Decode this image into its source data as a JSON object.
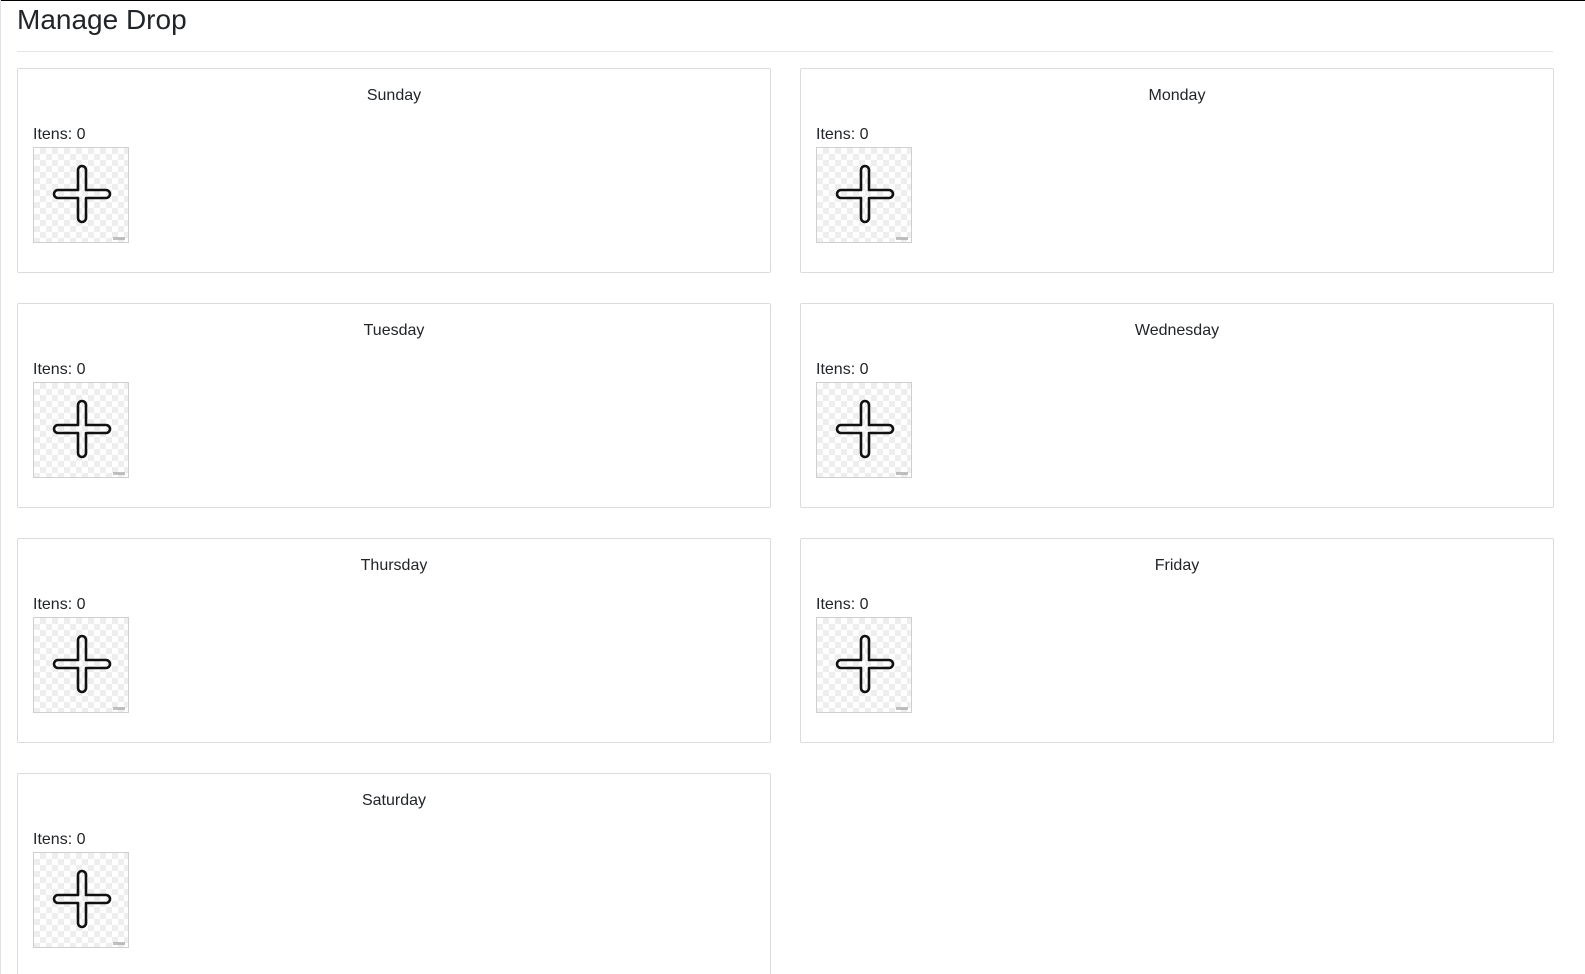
{
  "page": {
    "title": "Manage Drop"
  },
  "days": [
    {
      "name": "Sunday",
      "items_label": "Itens: 0",
      "add_icon": "plus-icon"
    },
    {
      "name": "Monday",
      "items_label": "Itens: 0",
      "add_icon": "plus-icon"
    },
    {
      "name": "Tuesday",
      "items_label": "Itens: 0",
      "add_icon": "plus-icon"
    },
    {
      "name": "Wednesday",
      "items_label": "Itens: 0",
      "add_icon": "plus-icon"
    },
    {
      "name": "Thursday",
      "items_label": "Itens: 0",
      "add_icon": "plus-icon"
    },
    {
      "name": "Friday",
      "items_label": "Itens: 0",
      "add_icon": "plus-icon"
    },
    {
      "name": "Saturday",
      "items_label": "Itens: 0",
      "add_icon": "plus-icon"
    }
  ]
}
